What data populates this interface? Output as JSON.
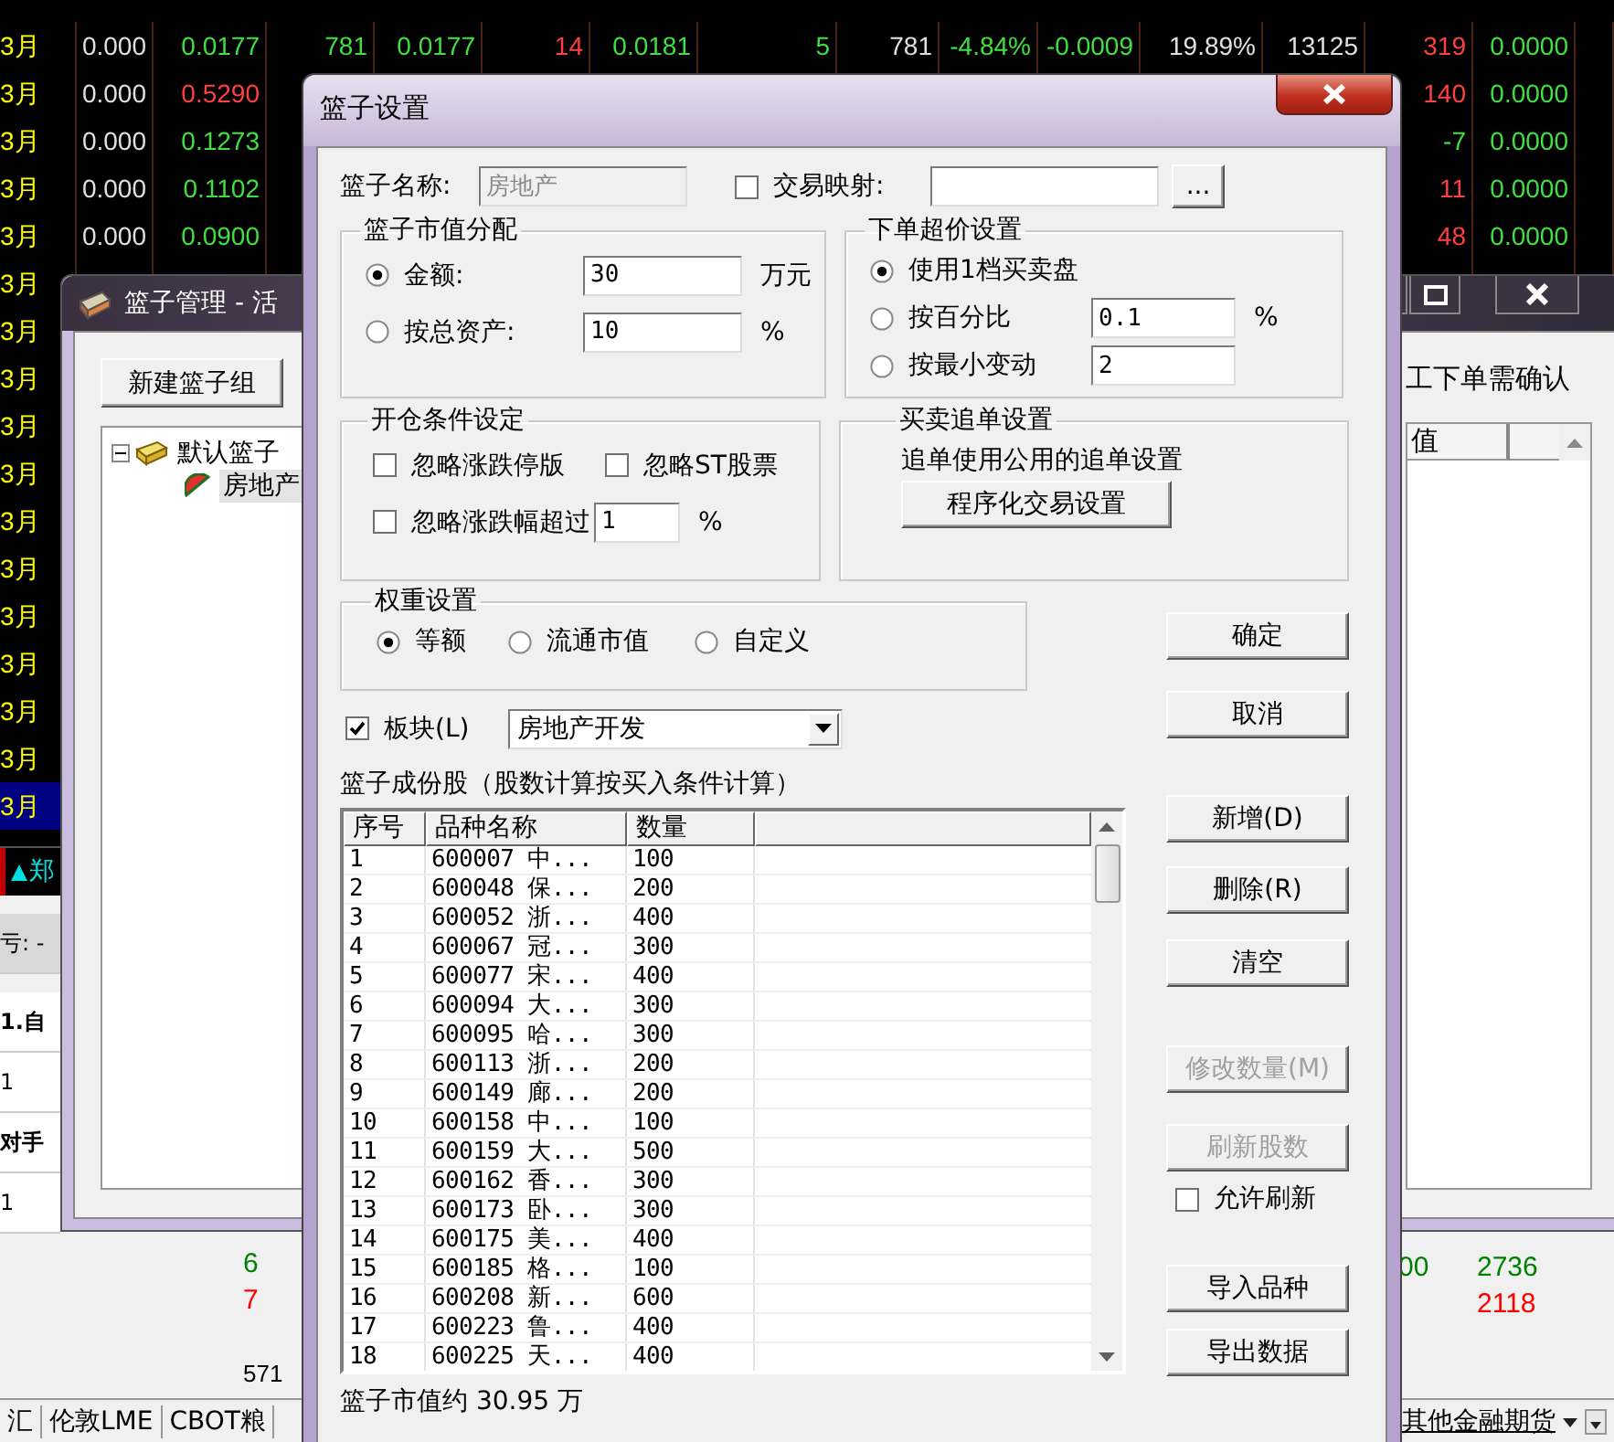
{
  "market_table": {
    "rows": [
      {
        "selected": false,
        "left": [
          {
            "text": "3月",
            "color": "#ffff00"
          },
          {
            "text": "0.000",
            "color": "#e0e0e0"
          },
          {
            "text": "0.0177",
            "color": "#40e040"
          },
          {
            "text": "781",
            "color": "#40e040"
          },
          {
            "text": "0.0177",
            "color": "#40e040"
          },
          {
            "text": "14",
            "color": "#ff4040"
          },
          {
            "text": "0.0181",
            "color": "#40e040"
          },
          {
            "text": "5",
            "color": "#40e040"
          },
          {
            "text": "781",
            "color": "#e0e0e0"
          },
          {
            "text": "-4.84%",
            "color": "#40e040"
          },
          {
            "text": "-0.0009",
            "color": "#40e040"
          },
          {
            "text": "19.89%",
            "color": "#e0e0e0"
          },
          {
            "text": "13125",
            "color": "#e0e0e0"
          },
          {
            "text": "319",
            "color": "#ff4040"
          },
          {
            "text": "0.0000",
            "color": "#40e040"
          }
        ]
      },
      {
        "selected": false,
        "left": [
          {
            "text": "3月",
            "color": "#ffff00"
          },
          {
            "text": "0.000",
            "color": "#e0e0e0"
          },
          {
            "text": "0.5290",
            "color": "#ff4040"
          }
        ],
        "right": [
          {
            "text": "140",
            "color": "#ff4040"
          },
          {
            "text": "0.0000",
            "color": "#40e040"
          }
        ]
      },
      {
        "selected": false,
        "left": [
          {
            "text": "3月",
            "color": "#ffff00"
          },
          {
            "text": "0.000",
            "color": "#e0e0e0"
          },
          {
            "text": "0.1273",
            "color": "#40e040"
          }
        ],
        "right": [
          {
            "text": "-7",
            "color": "#40e040"
          },
          {
            "text": "0.0000",
            "color": "#40e040"
          }
        ]
      },
      {
        "selected": false,
        "left": [
          {
            "text": "3月",
            "color": "#ffff00"
          },
          {
            "text": "0.000",
            "color": "#e0e0e0"
          },
          {
            "text": "0.1102",
            "color": "#40e040"
          }
        ],
        "right": [
          {
            "text": "11",
            "color": "#ff4040"
          },
          {
            "text": "0.0000",
            "color": "#40e040"
          }
        ]
      },
      {
        "selected": false,
        "left": [
          {
            "text": "3月",
            "color": "#ffff00"
          },
          {
            "text": "0.000",
            "color": "#e0e0e0"
          },
          {
            "text": "0.0900",
            "color": "#40e040"
          }
        ],
        "right": [
          {
            "text": "48",
            "color": "#ff4040"
          },
          {
            "text": "0.0000",
            "color": "#40e040"
          }
        ]
      },
      {
        "selected": false,
        "left": [
          {
            "text": "3月",
            "color": "#ffff00"
          }
        ]
      },
      {
        "selected": false,
        "left": [
          {
            "text": "3月",
            "color": "#ffff00"
          }
        ]
      },
      {
        "selected": false,
        "left": [
          {
            "text": "3月",
            "color": "#ffff00"
          }
        ]
      },
      {
        "selected": false,
        "left": [
          {
            "text": "3月",
            "color": "#ffff00"
          }
        ]
      },
      {
        "selected": false,
        "left": [
          {
            "text": "3月",
            "color": "#ffff00"
          }
        ]
      },
      {
        "selected": false,
        "left": [
          {
            "text": "3月",
            "color": "#ffff00"
          }
        ]
      },
      {
        "selected": false,
        "left": [
          {
            "text": "3月",
            "color": "#ffff00"
          }
        ]
      },
      {
        "selected": false,
        "left": [
          {
            "text": "3月",
            "color": "#ffff00"
          }
        ]
      },
      {
        "selected": false,
        "left": [
          {
            "text": "3月",
            "color": "#ffff00"
          }
        ]
      },
      {
        "selected": false,
        "left": [
          {
            "text": "3月",
            "color": "#ffff00"
          }
        ]
      },
      {
        "selected": false,
        "left": [
          {
            "text": "3月",
            "color": "#ffff00"
          }
        ]
      },
      {
        "selected": true,
        "left": [
          {
            "text": "3月",
            "color": "#ffff00"
          }
        ]
      }
    ]
  },
  "exchange_tab": {
    "label": "郑"
  },
  "trade_panel": [
    {
      "text": "亏: -",
      "bold": false
    },
    {
      "text": "1.自",
      "bold": true
    },
    {
      "text": "1",
      "bold": false
    },
    {
      "text": "对手",
      "bold": true
    },
    {
      "text": "1",
      "bold": false
    }
  ],
  "lower_grid": {
    "left": [
      {
        "text": "6",
        "color": "#008000"
      },
      {
        "text": "7",
        "color": "#ff0000"
      }
    ],
    "count": "571",
    "right": [
      {
        "text": "00",
        "color": "#008000"
      },
      {
        "text": "2736",
        "color": "#008000"
      },
      {
        "text": "2118",
        "color": "#ff0000"
      }
    ]
  },
  "bottom_tabs": {
    "left": [
      "汇",
      "伦敦LME",
      "CBOT粮"
    ],
    "right": "其他金融期货"
  },
  "basket_manager": {
    "title": "篮子管理 - 活",
    "new_group_button": "新建篮子组",
    "tree": [
      {
        "label": "默认篮子",
        "selected": false,
        "expanded": true,
        "children": [
          {
            "label": "房地产",
            "selected": true
          }
        ]
      }
    ],
    "confirm_label": "工下单需确认",
    "list_header": "值"
  },
  "dialog": {
    "title": "篮子设置",
    "name_label": "篮子名称:",
    "name_value": "房地产",
    "mapping": {
      "label": "交易映射:",
      "checked": false,
      "browse": "..."
    },
    "allocation": {
      "title": "篮子市值分配",
      "options": [
        {
          "label": "金额:",
          "selected": true,
          "value": "30",
          "unit": "万元"
        },
        {
          "label": "按总资产:",
          "selected": false,
          "value": "10",
          "unit": "%"
        }
      ]
    },
    "overprice": {
      "title": "下单超价设置",
      "options": [
        {
          "label": "使用1档买卖盘",
          "selected": true
        },
        {
          "label": "按百分比",
          "selected": false,
          "value": "0.1",
          "unit": "%"
        },
        {
          "label": "按最小变动",
          "selected": false,
          "value": "2"
        }
      ]
    },
    "open_conditions": {
      "title": "开仓条件设定",
      "checks": [
        {
          "label": "忽略涨跌停版",
          "checked": false
        },
        {
          "label": "忽略ST股票",
          "checked": false
        },
        {
          "label": "忽略涨跌幅超过",
          "checked": false,
          "value": "1",
          "unit": "%"
        }
      ]
    },
    "chase": {
      "title": "买卖追单设置",
      "note": "追单使用公用的追单设置",
      "button": "程序化交易设置"
    },
    "weight": {
      "title": "权重设置",
      "options": [
        {
          "label": "等额",
          "selected": true
        },
        {
          "label": "流通市值",
          "selected": false
        },
        {
          "label": "自定义",
          "selected": false
        }
      ]
    },
    "sector": {
      "label": "板块(L)",
      "checked": true,
      "value": "房地产开发"
    },
    "list_title": "篮子成份股（股数计算按买入条件计算）",
    "columns": [
      "序号",
      "品种名称",
      "数量"
    ],
    "rows": [
      [
        "1",
        "600007 中...",
        "100"
      ],
      [
        "2",
        "600048 保...",
        "200"
      ],
      [
        "3",
        "600052 浙...",
        "400"
      ],
      [
        "4",
        "600067 冠...",
        "300"
      ],
      [
        "5",
        "600077 宋...",
        "400"
      ],
      [
        "6",
        "600094 大...",
        "300"
      ],
      [
        "7",
        "600095 哈...",
        "300"
      ],
      [
        "8",
        "600113 浙...",
        "200"
      ],
      [
        "9",
        "600149 廊...",
        "200"
      ],
      [
        "10",
        "600158 中...",
        "100"
      ],
      [
        "11",
        "600159 大...",
        "500"
      ],
      [
        "12",
        "600162 香...",
        "300"
      ],
      [
        "13",
        "600173 卧...",
        "300"
      ],
      [
        "14",
        "600175 美...",
        "400"
      ],
      [
        "15",
        "600185 格...",
        "100"
      ],
      [
        "16",
        "600208 新...",
        "600"
      ],
      [
        "17",
        "600223 鲁...",
        "400"
      ],
      [
        "18",
        "600225 天...",
        "400"
      ]
    ],
    "total": "篮子市值约 30.95 万",
    "side_controls": [
      {
        "kind": "button",
        "label": "确定",
        "disabled": false
      },
      {
        "kind": "button",
        "label": "取消",
        "disabled": false
      },
      {
        "kind": "button",
        "label": "新增(D)",
        "disabled": false
      },
      {
        "kind": "button",
        "label": "删除(R)",
        "disabled": false
      },
      {
        "kind": "button",
        "label": "清空",
        "disabled": false
      },
      {
        "kind": "button",
        "label": "修改数量(M)",
        "disabled": true
      },
      {
        "kind": "button",
        "label": "刷新股数",
        "disabled": true
      },
      {
        "kind": "checkbox",
        "label": "允许刷新",
        "checked": false
      },
      {
        "kind": "button",
        "label": "导入品种",
        "disabled": false
      },
      {
        "kind": "button",
        "label": "导出数据",
        "disabled": false
      }
    ]
  }
}
